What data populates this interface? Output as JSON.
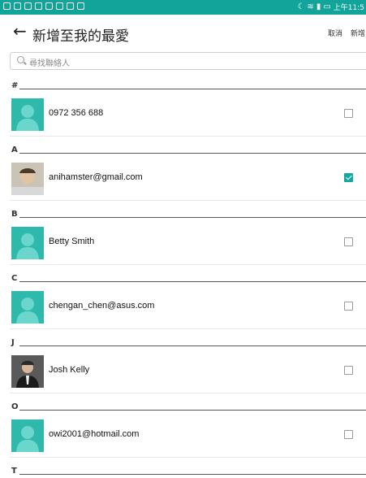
{
  "status_bar": {
    "time": "上午11:5"
  },
  "header": {
    "title": "新增至我的最愛",
    "cancel_label": "取消",
    "add_label": "新增"
  },
  "search": {
    "placeholder": "尋找聯絡人"
  },
  "sections": [
    {
      "letter": "#",
      "contacts": [
        {
          "name": "0972 356 688",
          "avatar": "default",
          "checked": false
        }
      ]
    },
    {
      "letter": "A",
      "contacts": [
        {
          "name": "anihamster@gmail.com",
          "avatar": "photo",
          "checked": true
        }
      ]
    },
    {
      "letter": "B",
      "contacts": [
        {
          "name": "Betty Smith",
          "avatar": "default",
          "checked": false
        }
      ]
    },
    {
      "letter": "C",
      "contacts": [
        {
          "name": "chengan_chen@asus.com",
          "avatar": "default",
          "checked": false
        }
      ]
    },
    {
      "letter": "J",
      "contacts": [
        {
          "name": "Josh Kelly",
          "avatar": "photo",
          "checked": false
        }
      ]
    },
    {
      "letter": "O",
      "contacts": [
        {
          "name": "owi2001@hotmail.com",
          "avatar": "default",
          "checked": false
        }
      ]
    },
    {
      "letter": "T",
      "contacts": []
    }
  ],
  "colors": {
    "accent": "#12a49a",
    "avatar_bg": "#2fb9ad"
  }
}
